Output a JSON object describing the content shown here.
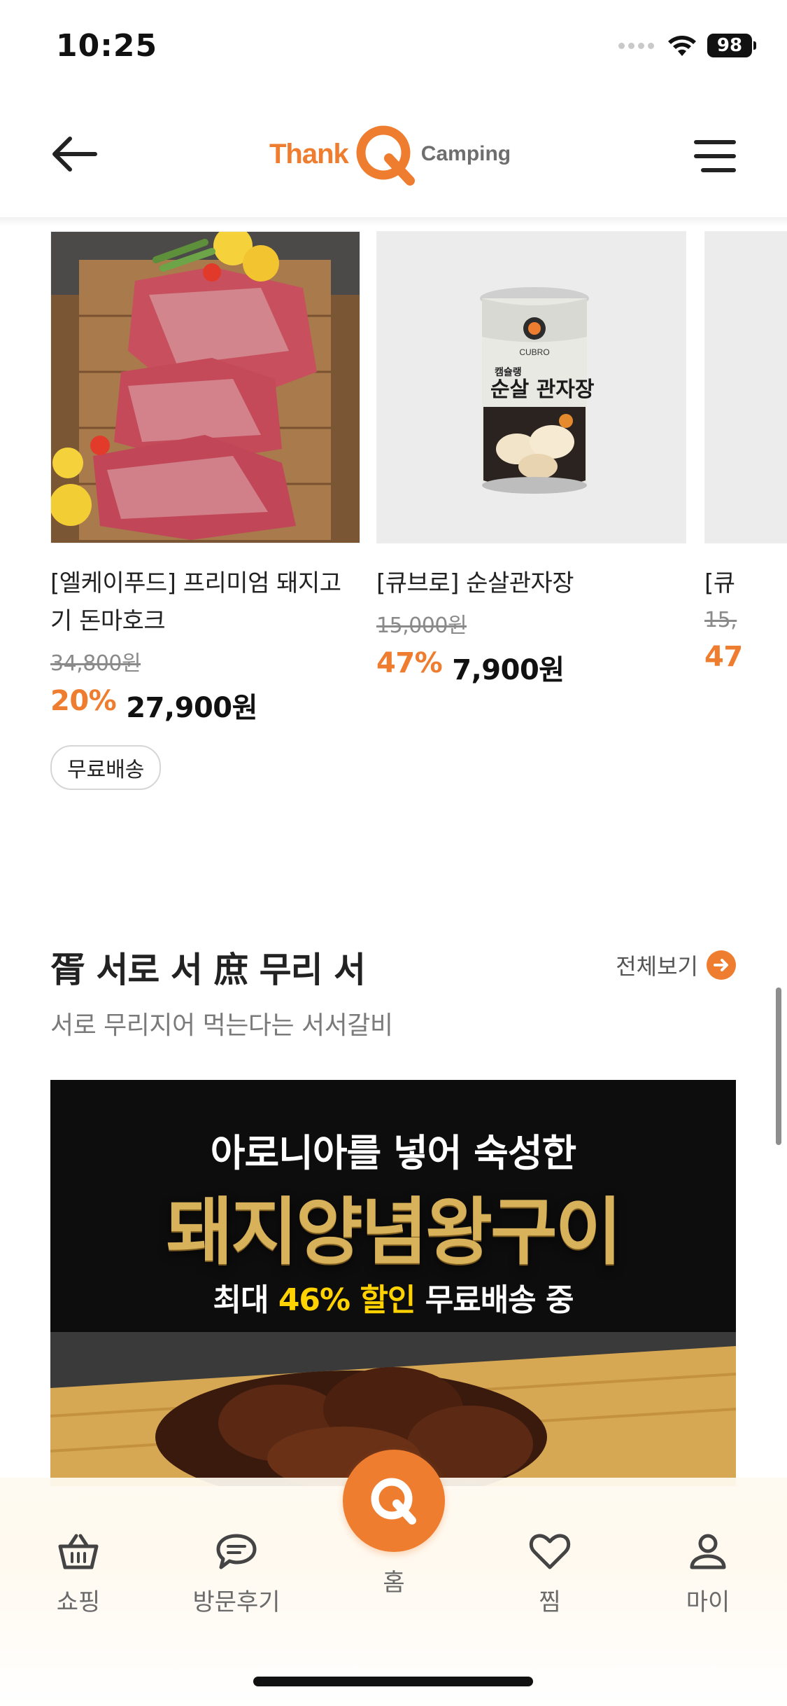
{
  "status_bar": {
    "time": "10:25",
    "battery": "98"
  },
  "header": {
    "logo_thank": "Thank",
    "logo_q": "Q",
    "logo_camping": "Camping"
  },
  "products": [
    {
      "name": "[엘케이푸드] 프리미엄 돼지고기 돈마호크",
      "original_price": "34,800원",
      "discount": "20%",
      "sale_price": "27,900원",
      "badge": "무료배송"
    },
    {
      "name": "[큐브로] 순살관자장",
      "original_price": "15,000원",
      "discount": "47%",
      "sale_price": "7,900원",
      "can_brand": "CUBRO",
      "can_label_small": "캠슐랭",
      "can_label": "순살 관자장"
    },
    {
      "name": "[큐",
      "original_price": "15,",
      "discount": "47"
    }
  ],
  "section": {
    "title": "胥 서로 서 庶 무리 서",
    "subtitle": "서로 무리지어 먹는다는 서서갈비",
    "see_all": "전체보기"
  },
  "banner": {
    "line1": "아로니아를 넣어 숙성한",
    "line2": "돼지양념왕구이",
    "line3_pre": "최대 ",
    "line3_highlight": "46% 할인",
    "line3_post": " 무료배송 중"
  },
  "bottom_nav": {
    "shopping": "쇼핑",
    "reviews": "방문후기",
    "home": "홈",
    "wishlist": "찜",
    "my": "마이"
  },
  "colors": {
    "accent": "#ef7d2f",
    "highlight": "#ffd200"
  }
}
